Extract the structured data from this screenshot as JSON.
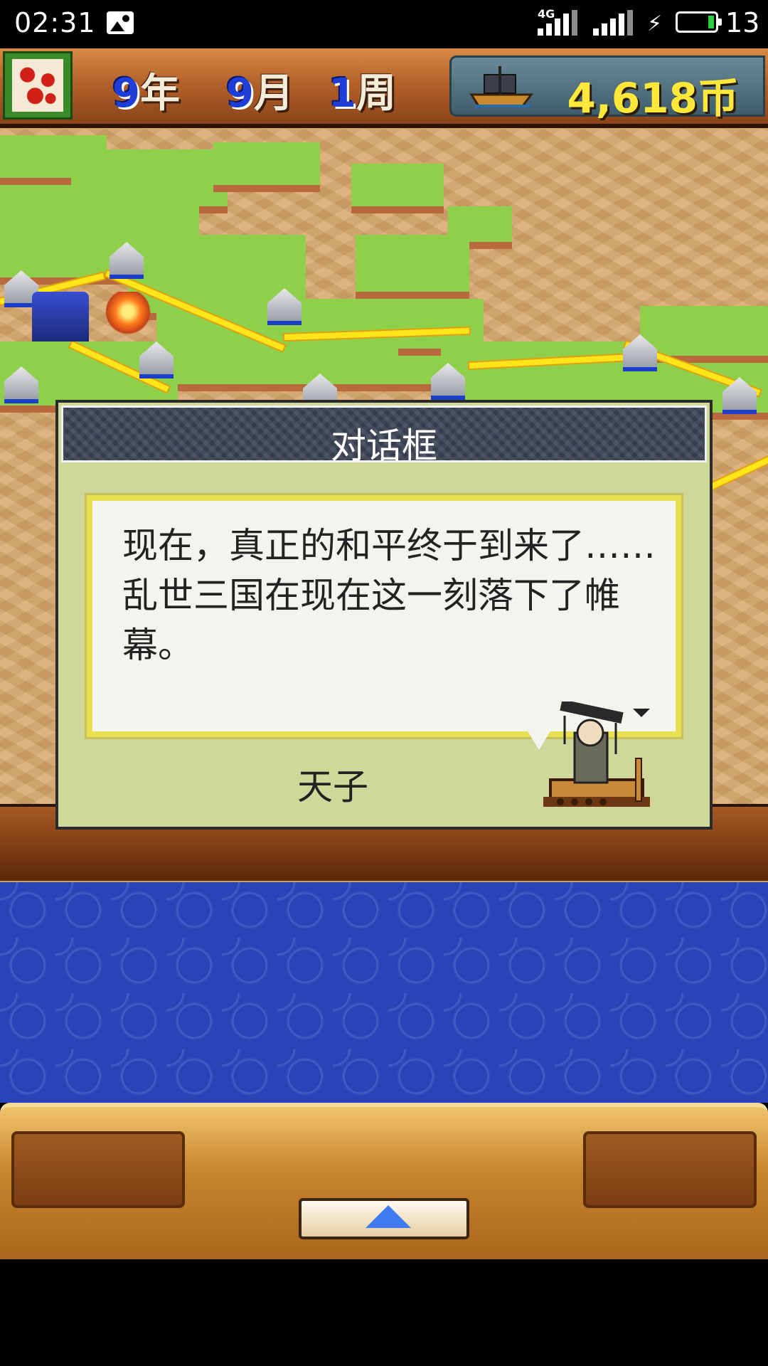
{
  "status_bar": {
    "time": "02:31",
    "network_label": "4G",
    "battery_level": "13",
    "icons": [
      "gallery-icon",
      "signal-icon",
      "signal-icon",
      "charging-bolt-icon",
      "battery-icon"
    ]
  },
  "top_bar": {
    "year_num": "9",
    "year_label": "年",
    "month_num": "9",
    "month_label": "月",
    "week_num": "1",
    "week_label": "周",
    "money": "4,618币",
    "icons": [
      "clan-emblem-icon",
      "ship-icon"
    ]
  },
  "dialog": {
    "title": "对话框",
    "message": "现在，真正的和平终于到来了……乱世三国在现在这一刻落下了帷幕。",
    "speaker": "天子"
  },
  "colors": {
    "dialog_bg": "#cfd89a",
    "speech_border": "#e8e050",
    "money_color": "#ffe83a",
    "date_number_color": "#1f3ed6",
    "blue_pattern": "#2a44b8"
  }
}
